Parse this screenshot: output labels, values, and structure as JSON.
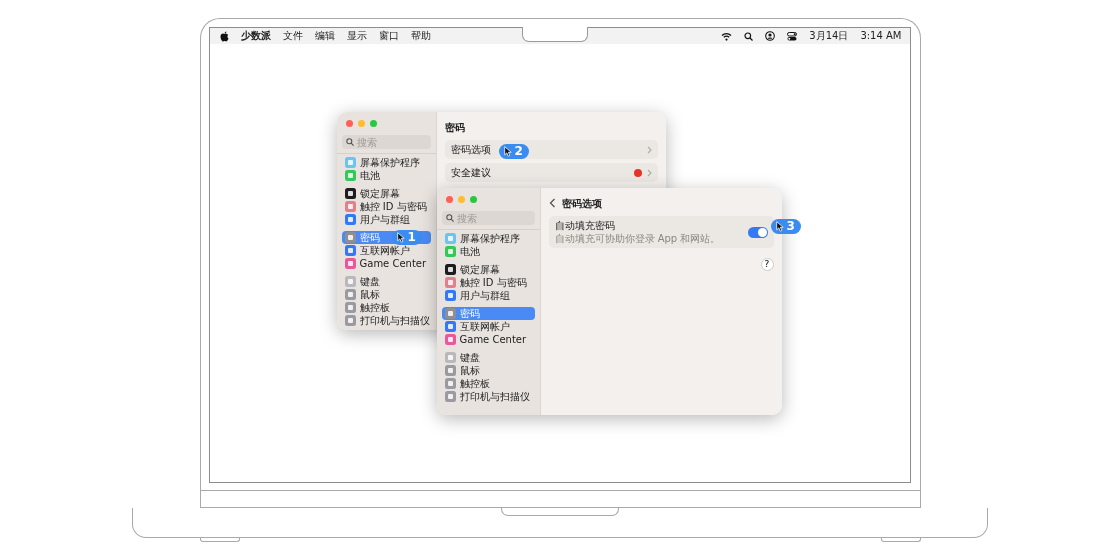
{
  "menu_bar": {
    "app_name": "少数派",
    "menus": [
      "文件",
      "编辑",
      "显示",
      "窗口",
      "帮助"
    ],
    "date": "3月14日",
    "time": "3:14 AM"
  },
  "windows": [
    {
      "search": {
        "placeholder": "搜索"
      },
      "sidebar": [
        [
          {
            "label": "屏幕保护程序",
            "color": "#6cc4f0",
            "selected": false
          },
          {
            "label": "电池",
            "color": "#34c759",
            "selected": false
          }
        ],
        [
          {
            "label": "锁定屏幕",
            "color": "#1d1d1f",
            "selected": false
          },
          {
            "label": "触控 ID 与密码",
            "color": "#e3808c",
            "selected": false
          },
          {
            "label": "用户与群组",
            "color": "#3478f6",
            "selected": false
          }
        ],
        [
          {
            "label": "密码",
            "color": "#8e8e93",
            "selected": true,
            "callout": "1"
          },
          {
            "label": "互联网帐户",
            "color": "#3478f6",
            "selected": false
          },
          {
            "label": "Game Center",
            "color": "#e8599b",
            "selected": false
          }
        ],
        [
          {
            "label": "键盘",
            "color": "#b8b8bd",
            "selected": false
          },
          {
            "label": "鼠标",
            "color": "#9a9aa0",
            "selected": false
          },
          {
            "label": "触控板",
            "color": "#9a9aa0",
            "selected": false
          },
          {
            "label": "打印机与扫描仪",
            "color": "#9a9aa0",
            "selected": false
          }
        ]
      ],
      "header": {
        "title": "密码"
      },
      "content": [
        {
          "kind": "link",
          "label": "密码选项",
          "alert": false,
          "callout": "2"
        },
        {
          "kind": "link",
          "label": "安全建议",
          "alert": true
        }
      ]
    },
    {
      "search": {
        "placeholder": "搜索"
      },
      "sidebar": [
        [
          {
            "label": "屏幕保护程序",
            "color": "#6cc4f0",
            "selected": false
          },
          {
            "label": "电池",
            "color": "#34c759",
            "selected": false
          }
        ],
        [
          {
            "label": "锁定屏幕",
            "color": "#1d1d1f",
            "selected": false
          },
          {
            "label": "触控 ID 与密码",
            "color": "#e3808c",
            "selected": false
          },
          {
            "label": "用户与群组",
            "color": "#3478f6",
            "selected": false
          }
        ],
        [
          {
            "label": "密码",
            "color": "#8e8e93",
            "selected": true
          },
          {
            "label": "互联网帐户",
            "color": "#3478f6",
            "selected": false
          },
          {
            "label": "Game Center",
            "color": "#e8599b",
            "selected": false
          }
        ],
        [
          {
            "label": "键盘",
            "color": "#b8b8bd",
            "selected": false
          },
          {
            "label": "鼠标",
            "color": "#9a9aa0",
            "selected": false
          },
          {
            "label": "触控板",
            "color": "#9a9aa0",
            "selected": false
          },
          {
            "label": "打印机与扫描仪",
            "color": "#9a9aa0",
            "selected": false
          }
        ]
      ],
      "header": {
        "title": "密码选项",
        "back_button": true
      },
      "content": [
        {
          "kind": "toggle",
          "label": "自动填充密码",
          "description": "自动填充可协助你登录 App 和网站。",
          "on": true,
          "callout": "3"
        }
      ],
      "help_button": "?"
    }
  ]
}
